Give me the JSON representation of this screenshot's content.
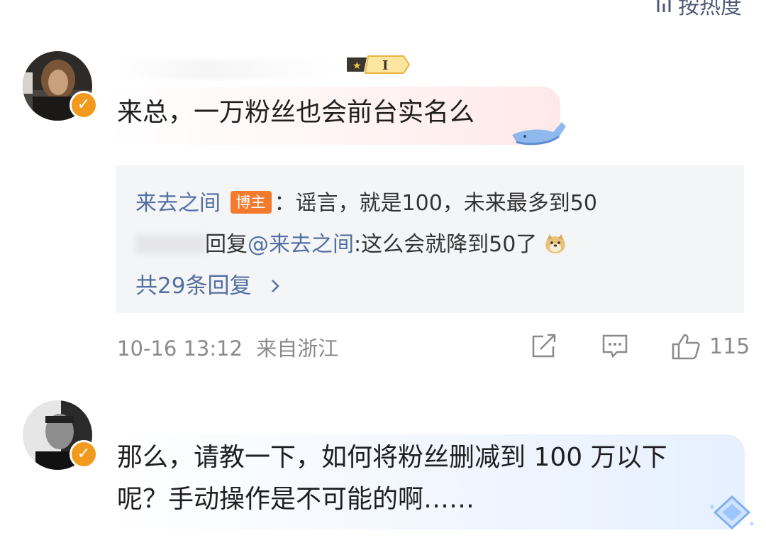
{
  "header": {
    "sort_label": "按热度"
  },
  "comments": [
    {
      "text": "来总，一万粉丝也会前台实名么",
      "replies": [
        {
          "author": "来去之间",
          "tag": "博主",
          "sep": "：",
          "text": "谣言，就是100，未来最多到50"
        },
        {
          "reply_word": "回复",
          "mention": "@来去之间",
          "sep": ":",
          "text": "这么会就降到50了"
        }
      ],
      "more_replies": "共29条回复",
      "time": "10-16 13:12",
      "location": "来自浙江",
      "likes": "115"
    },
    {
      "text_line1": "那么，请教一下，如何将粉丝删减到 100 万以下",
      "text_line2": "呢？手动操作是不可能的啊……"
    }
  ],
  "colors": {
    "link": "#536fa1",
    "author_tag": "#f47b2e",
    "verified": "#f29a1d",
    "meta": "#8a8a8a"
  }
}
